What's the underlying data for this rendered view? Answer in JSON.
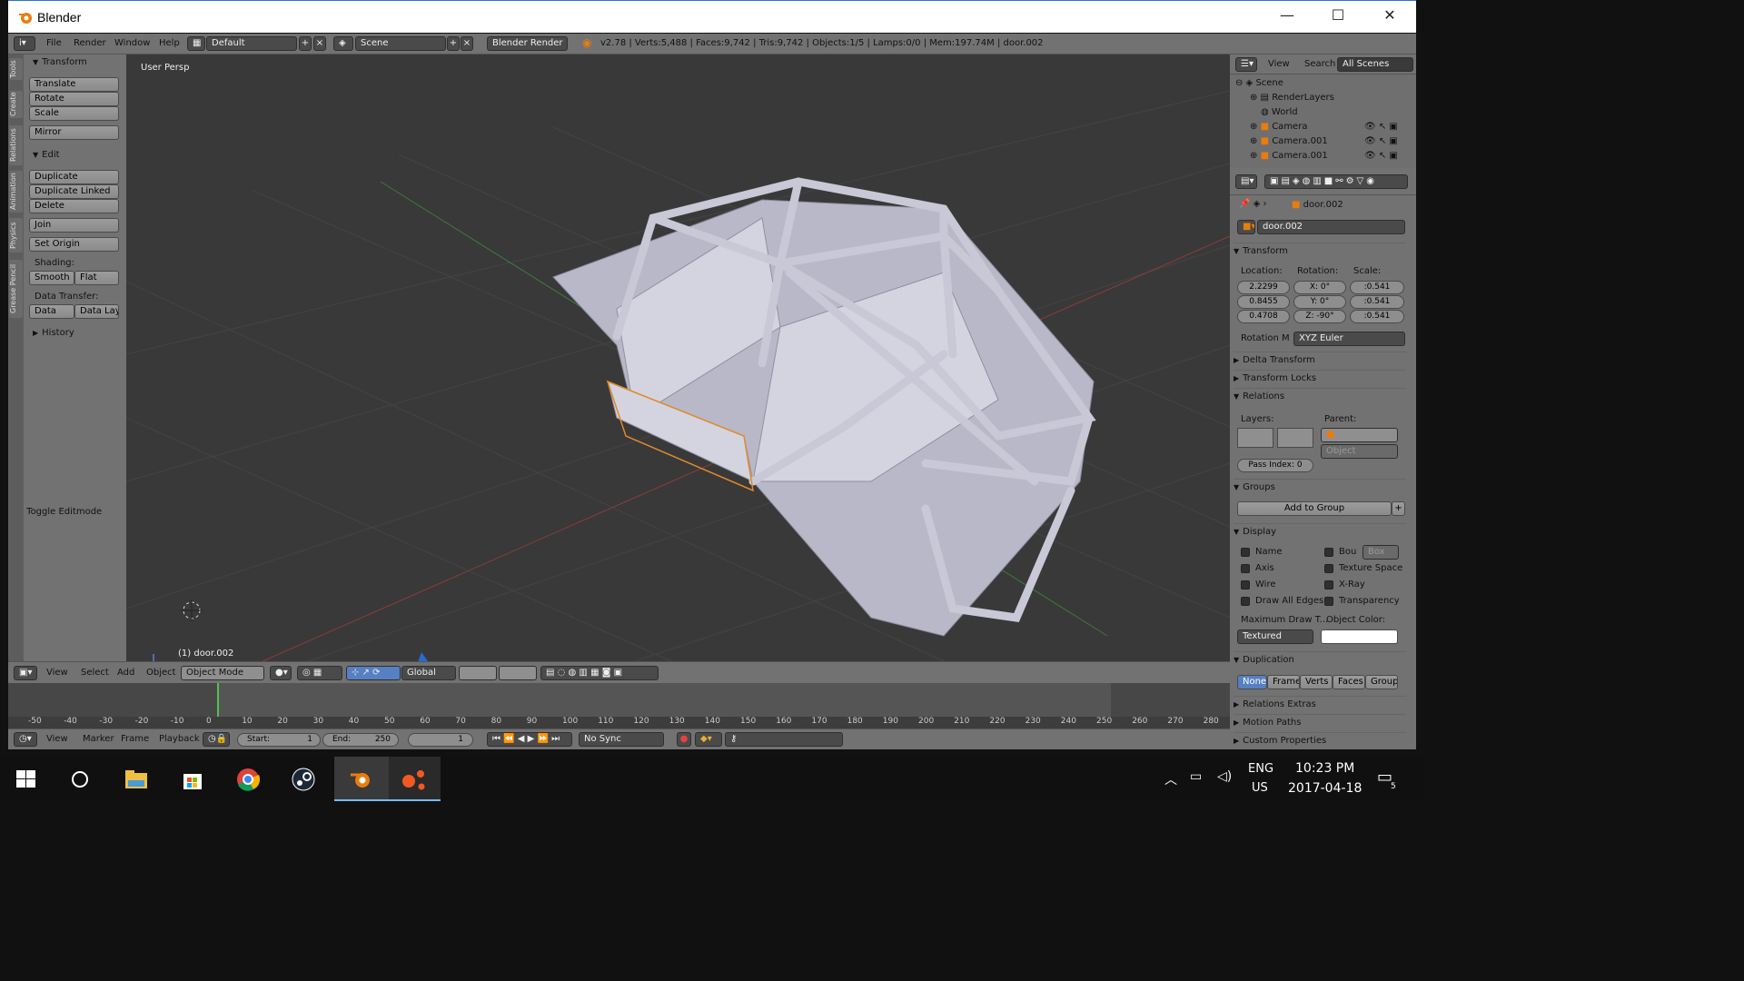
{
  "window": {
    "title": "Blender",
    "minimize": "—",
    "maximize": "☐",
    "close": "✕"
  },
  "topbar": {
    "menus": [
      "File",
      "Render",
      "Window",
      "Help"
    ],
    "layout": "Default",
    "scene": "Scene",
    "engine": "Blender Render",
    "stats": "v2.78 | Verts:5,488 | Faces:9,742 | Tris:9,742 | Objects:1/5 | Lamps:0/0 | Mem:197.74M | door.002"
  },
  "tool_tabs": [
    "Tools",
    "Create",
    "Relations",
    "Animation",
    "Physics",
    "Grease Pencil"
  ],
  "toolshelf": {
    "transform_title": "Transform",
    "translate": "Translate",
    "rotate": "Rotate",
    "scale": "Scale",
    "mirror": "Mirror",
    "edit_title": "Edit",
    "duplicate": "Duplicate",
    "duplicate_linked": "Duplicate Linked",
    "delete": "Delete",
    "join": "Join",
    "set_origin": "Set Origin",
    "shading_label": "Shading:",
    "smooth": "Smooth",
    "flat": "Flat",
    "data_transfer_label": "Data Transfer:",
    "data": "Data",
    "data_layo": "Data Layo",
    "history": "History",
    "toggle_editmode": "Toggle Editmode"
  },
  "viewport": {
    "view_label": "User Persp",
    "object_label": "(1) door.002"
  },
  "viewport_header": {
    "menus": [
      "View",
      "Select",
      "Add",
      "Object"
    ],
    "mode": "Object Mode",
    "orientation": "Global"
  },
  "timeline": {
    "ticks": [
      "-50",
      "-40",
      "-30",
      "-20",
      "-10",
      "0",
      "10",
      "20",
      "30",
      "40",
      "50",
      "60",
      "70",
      "80",
      "90",
      "100",
      "110",
      "120",
      "130",
      "140",
      "150",
      "160",
      "170",
      "180",
      "190",
      "200",
      "210",
      "220",
      "230",
      "240",
      "250",
      "260",
      "270",
      "280"
    ],
    "current_frame": 0
  },
  "timeline_header": {
    "menus": [
      "View",
      "Marker",
      "Frame",
      "Playback"
    ],
    "start": "Start:",
    "start_val": "1",
    "end": "End:",
    "end_val": "250",
    "frame": "1",
    "sync": "No Sync"
  },
  "outliner": {
    "menus": [
      "View",
      "Search"
    ],
    "filter": "All Scenes",
    "items": [
      "Scene",
      "RenderLayers",
      "World",
      "Camera",
      "Camera.001",
      "Camera.001"
    ]
  },
  "properties": {
    "breadcrumb": "door.002",
    "object_name": "door.002",
    "transform_title": "Transform",
    "location_label": "Location:",
    "rotation_label": "Rotation:",
    "scale_label": "Scale:",
    "location": [
      "2.2299",
      "0.8455",
      "0.4708"
    ],
    "rotation": [
      "X:      0°",
      "Y:      0°",
      "Z: -90°"
    ],
    "scale": [
      ":0.541",
      ":0.541",
      ":0.541"
    ],
    "rotation_mode_label": "Rotation M",
    "rotation_mode": "XYZ Euler",
    "delta_transform": "Delta Transform",
    "transform_locks": "Transform Locks",
    "relations": "Relations",
    "layers_label": "Layers:",
    "parent_label": "Parent:",
    "parent_type": "Object",
    "pass_index": "Pass Index:",
    "pass_index_val": "0",
    "groups": "Groups",
    "add_to_group": "Add to Group",
    "display": "Display",
    "display_opts_left": [
      "Name",
      "Axis",
      "Wire",
      "Draw All Edges"
    ],
    "display_opts_right": [
      "Bou",
      "Texture Space",
      "X-Ray",
      "Transparency"
    ],
    "bound_type": "Box",
    "max_draw_label": "Maximum Draw T...",
    "object_color_label": "Object Color:",
    "draw_type": "Textured",
    "duplication": "Duplication",
    "dup_opts": [
      "None",
      "Frames",
      "Verts",
      "Faces",
      "Group"
    ],
    "relations_extras": "Relations Extras",
    "motion_paths": "Motion Paths",
    "custom_properties": "Custom Properties"
  },
  "taskbar": {
    "lang1": "ENG",
    "lang2": "US",
    "time": "10:23 PM",
    "date": "2017-04-18",
    "notif": "5"
  },
  "colors": {
    "accent": "#5680c2",
    "blender_orange": "#e87d0d",
    "viewport_bg": "#393939",
    "panel_bg": "#727272"
  }
}
